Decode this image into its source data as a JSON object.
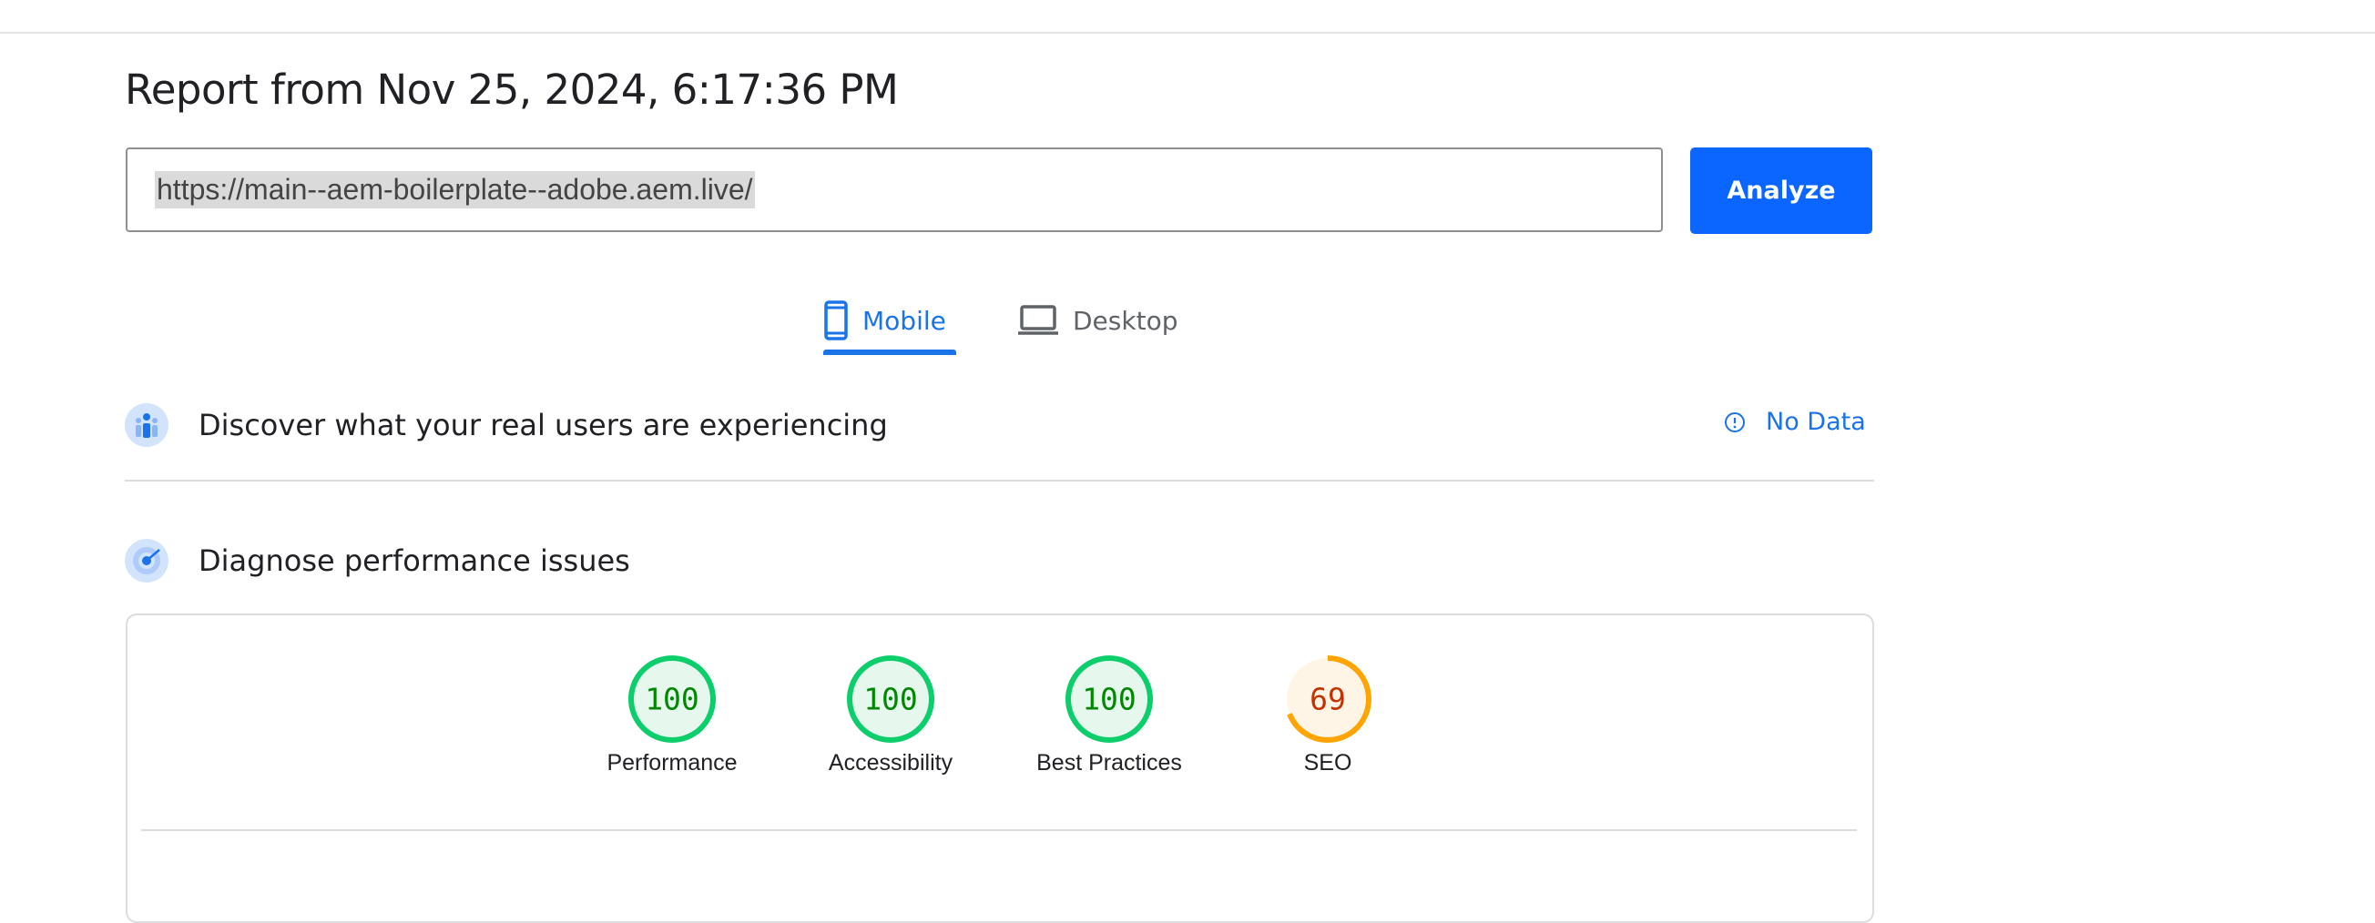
{
  "report": {
    "title": "Report from Nov 25, 2024, 6:17:36 PM"
  },
  "url_input": {
    "value": "https://main--aem-boilerplate--adobe.aem.live/"
  },
  "analyze_button": {
    "label": "Analyze"
  },
  "tabs": [
    {
      "label": "Mobile",
      "icon": "mobile-phone-icon",
      "selected": true
    },
    {
      "label": "Desktop",
      "icon": "laptop-icon",
      "selected": false
    }
  ],
  "field_data": {
    "title": "Discover what your real users are experiencing",
    "status": "No Data",
    "icon": "users-icon"
  },
  "lab_data": {
    "title": "Diagnose performance issues",
    "icon": "radar-icon"
  },
  "scores": [
    {
      "label": "Performance",
      "score": "100",
      "value": 100,
      "rating": "good"
    },
    {
      "label": "Accessibility",
      "score": "100",
      "value": 100,
      "rating": "good"
    },
    {
      "label": "Best Practices",
      "score": "100",
      "value": 100,
      "rating": "good"
    },
    {
      "label": "SEO",
      "score": "69",
      "value": 69,
      "rating": "average"
    }
  ],
  "colors": {
    "accent": "#1a73e8",
    "analyze_button": "#0b66ff",
    "good_stroke": "#0cce6b",
    "good_fill": "#e6f8ee",
    "good_text": "#008800",
    "average_stroke": "#ffa400",
    "average_fill": "#fff5e6",
    "average_text": "#c33300"
  }
}
